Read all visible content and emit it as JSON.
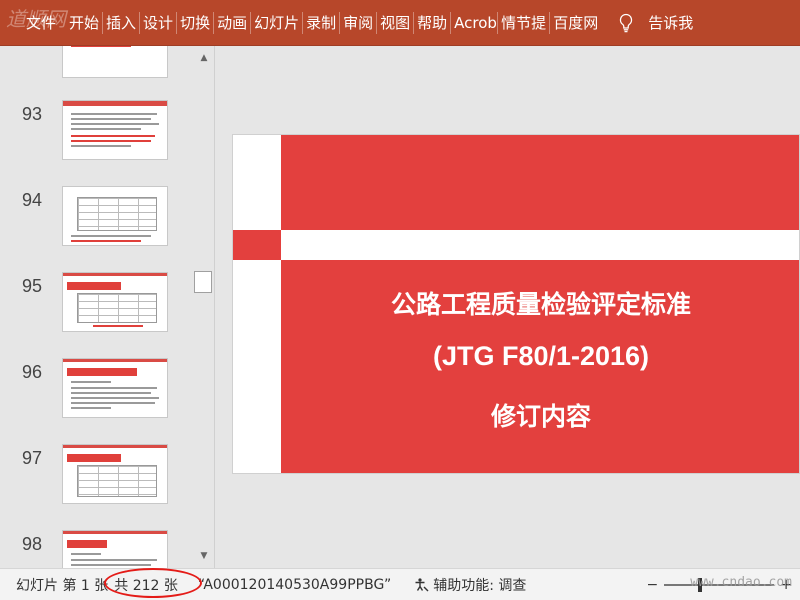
{
  "ribbon": {
    "watermark_logo": "道顺网",
    "tabs": [
      {
        "label": "文件"
      },
      {
        "label": "开始"
      },
      {
        "label": "插入"
      },
      {
        "label": "设计"
      },
      {
        "label": "切换"
      },
      {
        "label": "动画"
      },
      {
        "label": "幻灯片"
      },
      {
        "label": "录制"
      },
      {
        "label": "审阅"
      },
      {
        "label": "视图"
      },
      {
        "label": "帮助"
      },
      {
        "label": "Acrob"
      },
      {
        "label": "情节提"
      },
      {
        "label": "百度网"
      }
    ],
    "tell_me_icon": "lightbulb-icon",
    "tell_me_label": "告诉我",
    "colors": {
      "ribbon_bg": "#b7472a",
      "accent": "#e3403e"
    }
  },
  "thumbnails": [
    {
      "number": "",
      "kind": "text"
    },
    {
      "number": "93",
      "kind": "text"
    },
    {
      "number": "94",
      "kind": "table"
    },
    {
      "number": "95",
      "kind": "chip-table"
    },
    {
      "number": "96",
      "kind": "chip-text"
    },
    {
      "number": "97",
      "kind": "chip-table"
    },
    {
      "number": "98",
      "kind": "chip-text"
    }
  ],
  "slide": {
    "title_line1": "公路工程质量检验评定标准",
    "title_line2": "(JTG F80/1-2016)",
    "title_line3": "修订内容"
  },
  "status": {
    "slide_label": "幻灯片 第 1 张",
    "total_label": "共 212 张",
    "theme_label": "“A000120140530A99PPBG”",
    "accessibility_label": "辅助功能: 调查",
    "zoom_minus": "−",
    "zoom_plus": "+",
    "site_watermark": "www.cndao.com"
  }
}
